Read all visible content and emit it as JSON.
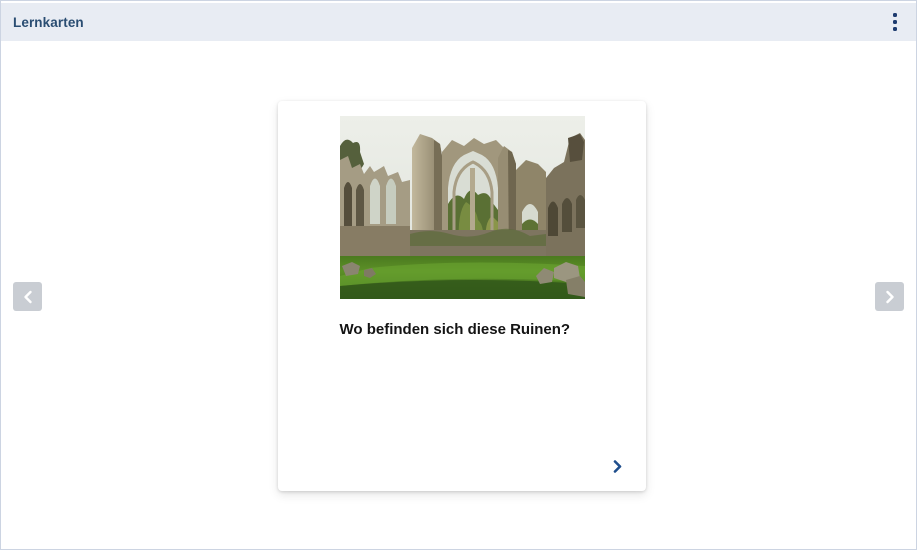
{
  "header": {
    "title": "Lernkarten"
  },
  "card": {
    "question": "Wo befinden sich diese Ruinen?",
    "image_description": "Gotische Klosterruine mit Spitzbogenfenstern, Bäumen hinter den Fenstern und grüner Rasenfläche"
  },
  "icons": {
    "menu": "kebab-menu-icon",
    "prev": "chevron-left-icon",
    "next": "chevron-right-icon",
    "flip": "chevron-right-icon"
  },
  "colors": {
    "header_bg": "#e8ecf3",
    "header_text": "#2a4d72",
    "accent_blue": "#1f4e8c",
    "nav_button_bg": "#c9cdd3",
    "page_border": "#ccd4e2"
  }
}
